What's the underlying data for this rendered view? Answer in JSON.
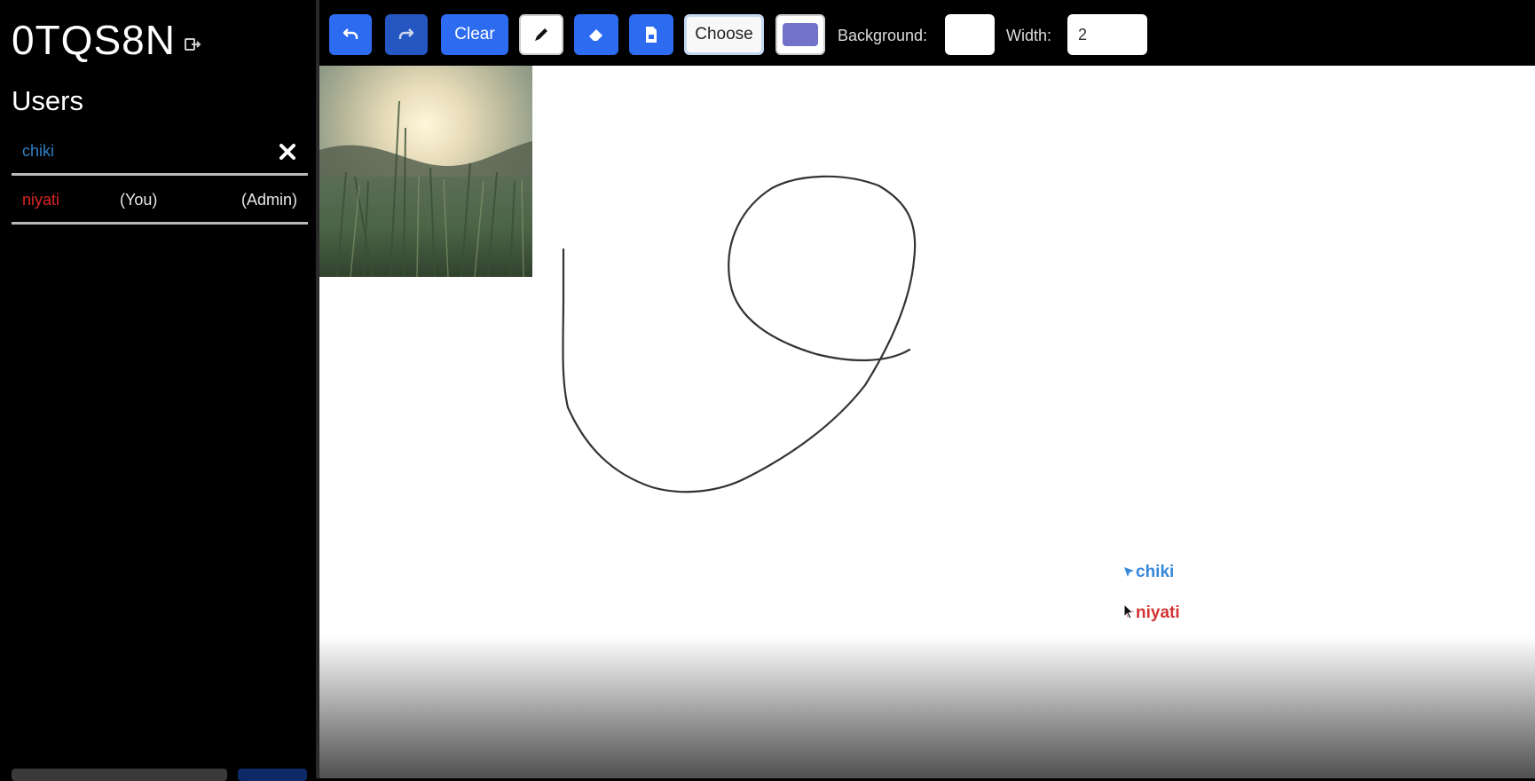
{
  "room": {
    "code": "0TQS8N"
  },
  "users": {
    "title": "Users",
    "list": [
      {
        "name": "chiki"
      },
      {
        "name": "niyati",
        "you_tag": "(You)",
        "admin_tag": "(Admin)"
      }
    ]
  },
  "toolbar": {
    "clear_label": "Clear",
    "choose_label": "Choose",
    "background_label": "Background:",
    "width_label": "Width:",
    "width_value": "2",
    "stroke_color": "#7272c8",
    "background_color": "#ffffff"
  },
  "canvas": {
    "cursors": [
      {
        "name": "chiki",
        "color": "#3688d8"
      },
      {
        "name": "niyati",
        "color": "#d33434"
      }
    ]
  },
  "colors": {
    "accent_blue": "#2d6bf0",
    "user_blue": "#2f7fc4",
    "user_red": "#d92525"
  }
}
